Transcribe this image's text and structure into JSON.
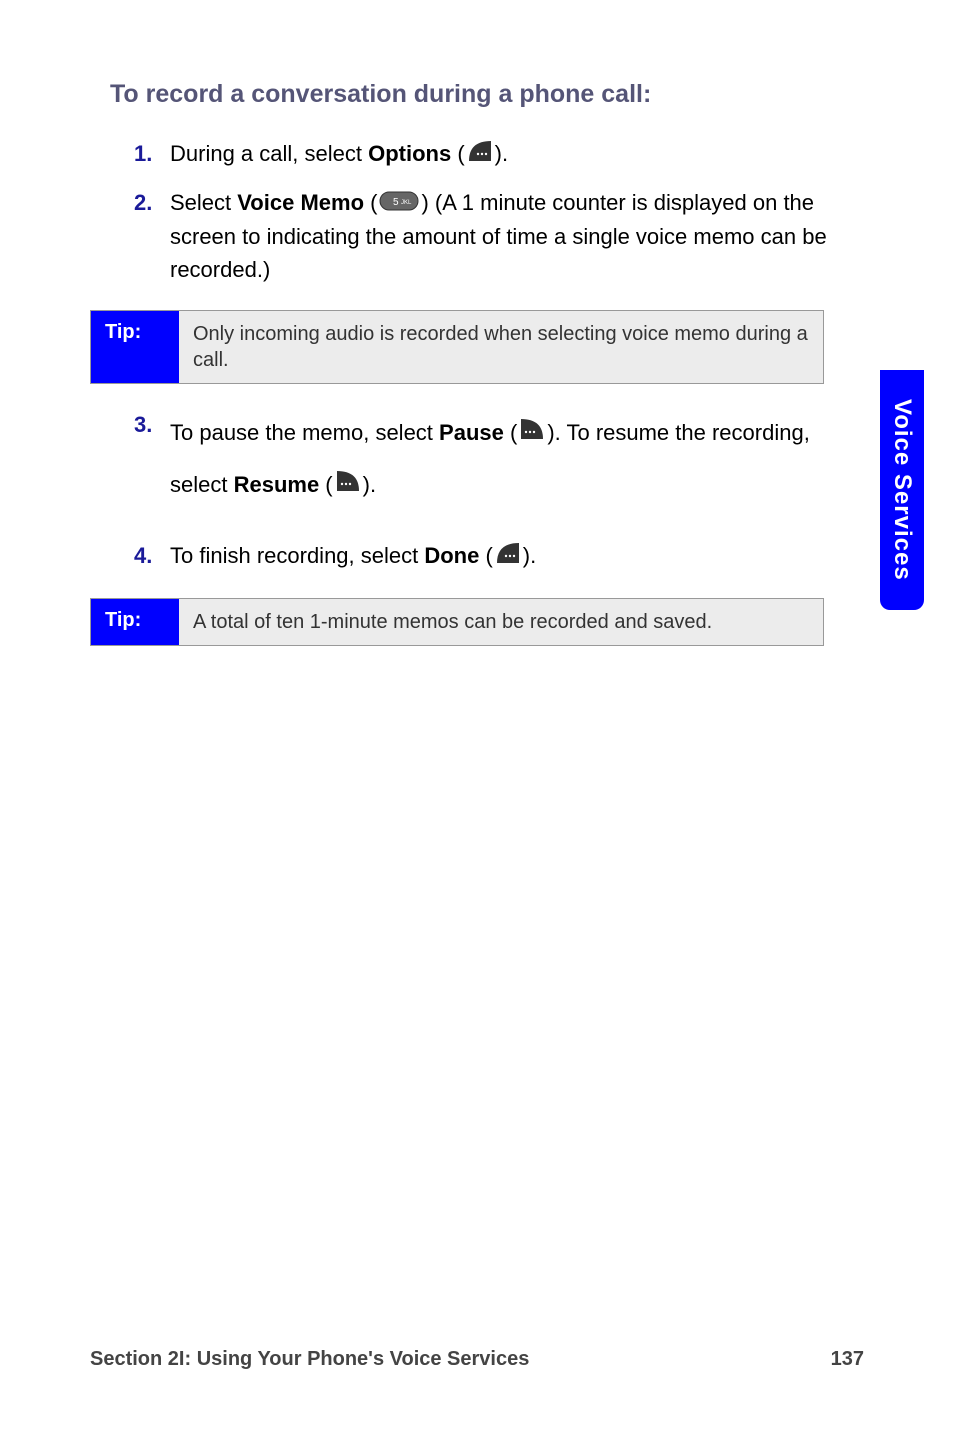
{
  "heading": "To record a conversation during a phone call:",
  "steps": [
    {
      "num": "1.",
      "pre": "During a call, select ",
      "boldA": "Options",
      "mid": " (",
      "post": ")."
    },
    {
      "num": "2.",
      "pre": "Select ",
      "boldA": "Voice Memo",
      "mid": " (",
      "post": ") (A 1 minute counter is displayed on the screen to indicating the amount of time a single voice memo can be recorded.)"
    },
    {
      "num": "3.",
      "pre": "To pause the memo, select ",
      "boldA": "Pause",
      "mid": " (",
      "midPost": "). To resume the recording, select ",
      "boldB": "Resume",
      "mid2": " (",
      "post": ")."
    },
    {
      "num": "4.",
      "pre": "To finish recording, select ",
      "boldA": "Done",
      "mid": " (",
      "post": ")."
    }
  ],
  "tip1": {
    "label": "Tip:",
    "text": "Only incoming audio is recorded when selecting voice memo during a call."
  },
  "tip2": {
    "label": "Tip:",
    "text": "A total of ten 1-minute memos can be recorded and saved."
  },
  "sideTab": "Voice Services",
  "footer": {
    "left": "Section 2I: Using Your Phone's Voice Services",
    "right": "137"
  }
}
